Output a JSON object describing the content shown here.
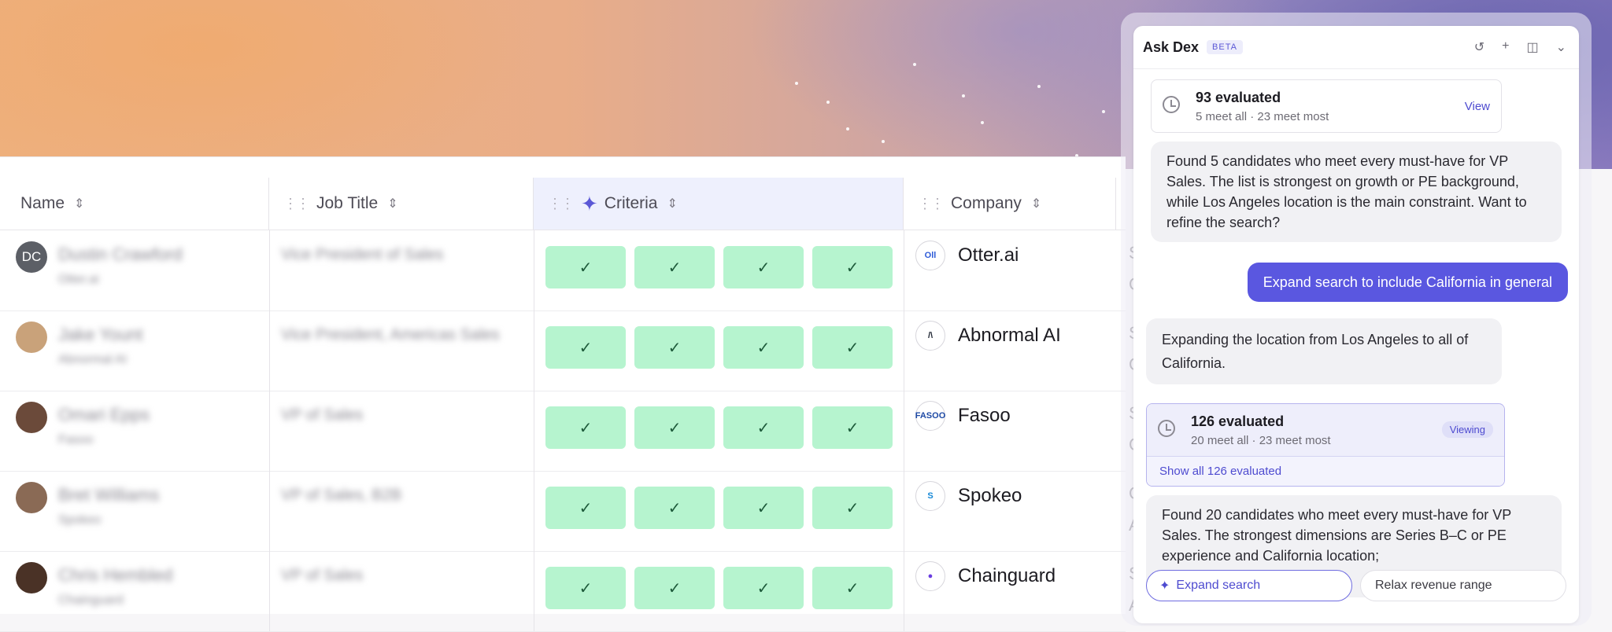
{
  "table": {
    "headers": {
      "name": "Name",
      "job_title": "Job Title",
      "criteria": "Criteria",
      "company": "Company"
    },
    "rows": [
      {
        "initials": "DC",
        "name": "Dustin Crawford",
        "company_sub": "Otter.ai",
        "job_title": "Vice President of Sales",
        "company": "Otter.ai",
        "logo_text": "Oll",
        "logo_color": "#2e5bd8",
        "extra": [
          "S",
          "C"
        ]
      },
      {
        "initials": "",
        "name": "Jake Yount",
        "company_sub": "Abnormal AI",
        "job_title": "Vice President, Americas Sales",
        "company": "Abnormal AI",
        "logo_text": "/\\",
        "logo_color": "#1c2330",
        "extra": [
          "S",
          "C"
        ]
      },
      {
        "initials": "",
        "name": "Omari Epps",
        "company_sub": "Fasoo",
        "job_title": "VP of Sales",
        "company": "Fasoo",
        "logo_text": "FASOO",
        "logo_color": "#1e4aa5",
        "extra": [
          "S",
          "C"
        ]
      },
      {
        "initials": "",
        "name": "Bret Williams",
        "company_sub": "Spokeo",
        "job_title": "VP of Sales, B2B",
        "company": "Spokeo",
        "logo_text": "S",
        "logo_color": "#1487d6",
        "extra": [
          "C",
          "A"
        ]
      },
      {
        "initials": "",
        "name": "Chris Hembled",
        "company_sub": "Chainguard",
        "job_title": "VP of Sales",
        "company": "Chainguard",
        "logo_text": "●",
        "logo_color": "#6a3de0",
        "extra": [
          "S",
          "A"
        ]
      }
    ],
    "check_glyph": "✓"
  },
  "panel": {
    "title": "Ask Dex",
    "badge": "BETA",
    "eval1": {
      "title": "93 evaluated",
      "sub": "5 meet all · 23 meet most",
      "action": "View"
    },
    "msg1": "Found 5 candidates who meet every must-have for VP Sales. The list is strongest on growth or PE background, while Los Angeles location is the main constraint. Want to refine the search?",
    "user_msg": "Expand search to include California in general",
    "msg2": "Expanding the location from Los Angeles to all of California.",
    "eval2": {
      "title": "126 evaluated",
      "sub": "20 meet all · 23 meet most",
      "badge": "Viewing",
      "link": "Show all 126 evaluated"
    },
    "msg3": "Found 20 candidates who meet every must-have for VP Sales. The strongest dimensions are Series B–C or PE experience and California location;",
    "chips": [
      "Expand search",
      "Relax revenue range"
    ]
  }
}
